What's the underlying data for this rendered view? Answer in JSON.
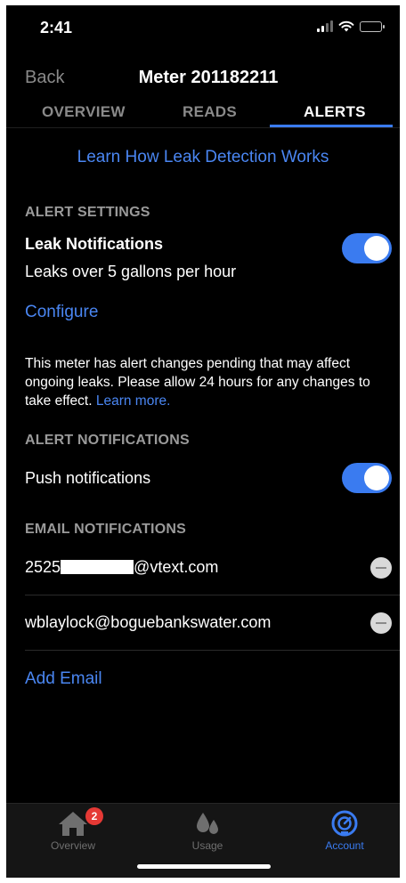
{
  "status_bar": {
    "time": "2:41"
  },
  "nav": {
    "back_label": "Back",
    "title": "Meter 201182211"
  },
  "tabs": [
    {
      "label": "OVERVIEW",
      "active": false
    },
    {
      "label": "READS",
      "active": false
    },
    {
      "label": "ALERTS",
      "active": true
    }
  ],
  "learn_link": "Learn How Leak Detection Works",
  "alert_settings": {
    "heading": "ALERT SETTINGS",
    "leak_title": "Leak Notifications",
    "leak_subtitle": "Leaks over 5 gallons per hour",
    "leak_enabled": true,
    "configure_label": "Configure"
  },
  "notice": {
    "text": "This meter has alert changes pending that may affect ongoing leaks. Please allow 24 hours for any changes to take effect.",
    "link": "Learn more."
  },
  "alert_notifications": {
    "heading": "ALERT NOTIFICATIONS",
    "push_label": "Push notifications",
    "push_enabled": true
  },
  "email_notifications": {
    "heading": "EMAIL NOTIFICATIONS",
    "emails": [
      {
        "prefix": "2525",
        "suffix": "@vtext.com",
        "redacted": true
      },
      {
        "prefix": "wblaylock@boguebankswater.com",
        "suffix": "",
        "redacted": false
      }
    ],
    "add_label": "Add Email"
  },
  "tabbar": {
    "items": [
      {
        "label": "Overview",
        "icon": "home-icon",
        "badge": "2",
        "active": false
      },
      {
        "label": "Usage",
        "icon": "water-drops-icon",
        "active": false
      },
      {
        "label": "Account",
        "icon": "gauge-icon",
        "active": true
      }
    ]
  },
  "colors": {
    "accent": "#3a7bf0",
    "link": "#4a86f2",
    "background": "#000000",
    "muted": "#9a9a9a",
    "badge": "#e53935"
  }
}
